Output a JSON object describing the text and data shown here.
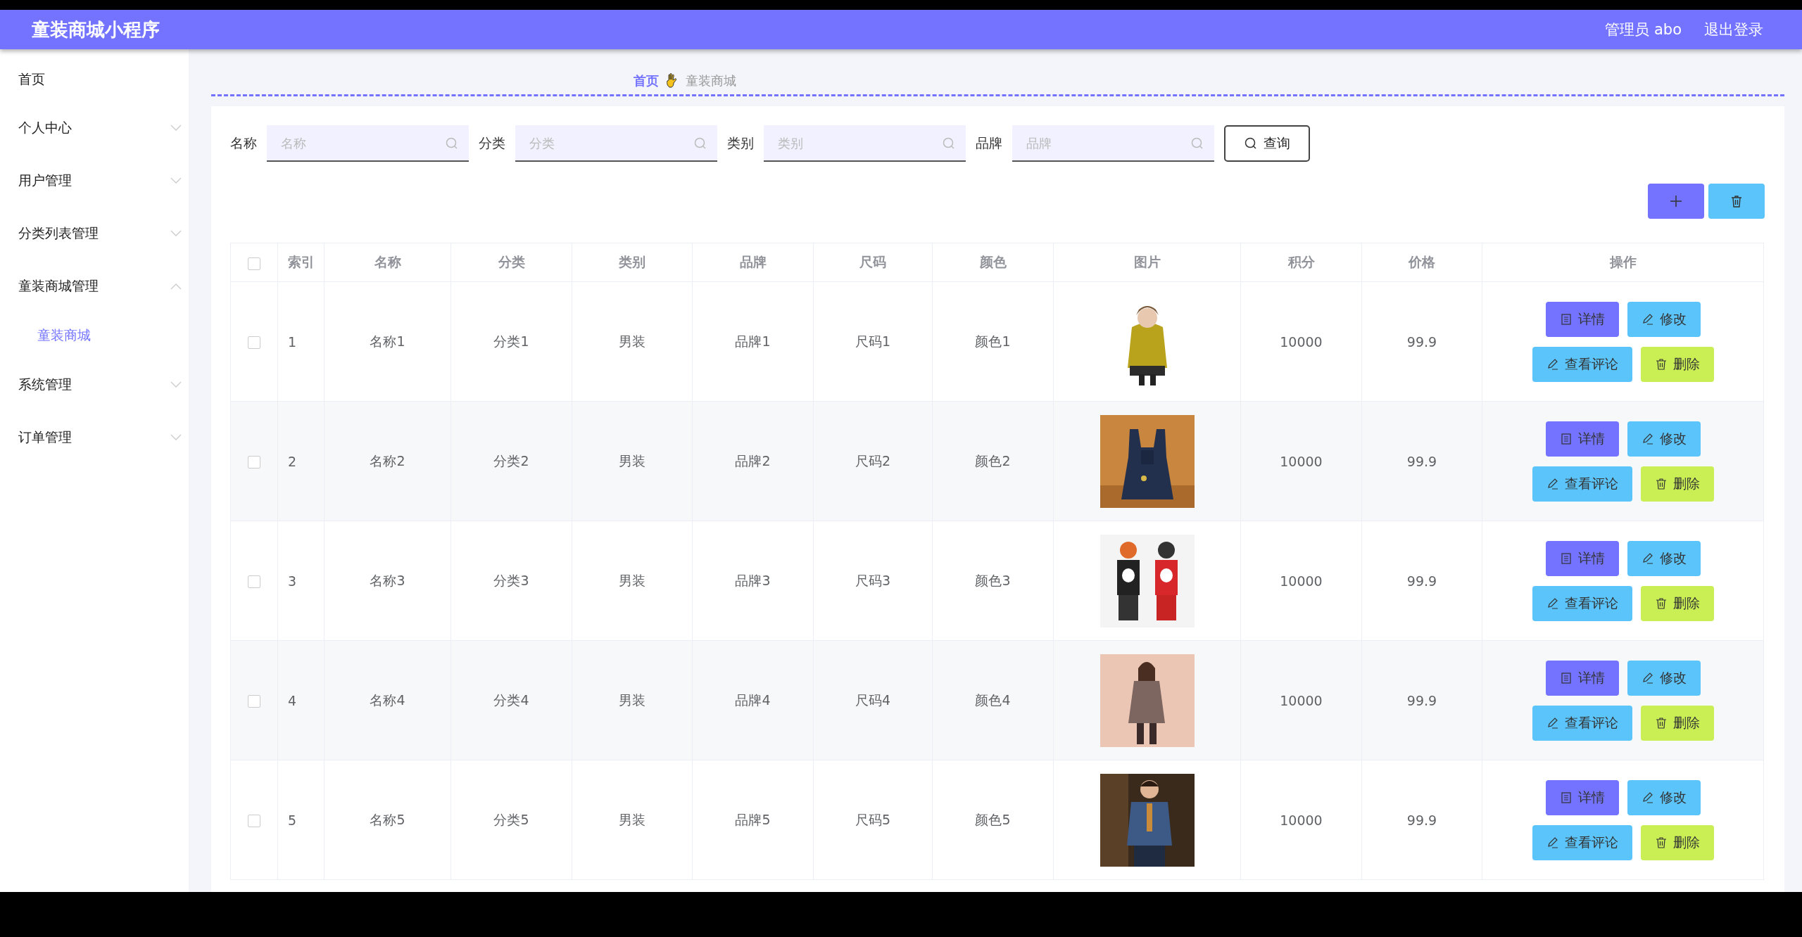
{
  "header": {
    "title": "童装商城小程序",
    "user": "管理员 abo",
    "logout": "退出登录"
  },
  "sidebar": {
    "items": [
      {
        "label": "首页",
        "kind": "link"
      },
      {
        "label": "个人中心",
        "kind": "menu",
        "expanded": false
      },
      {
        "label": "用户管理",
        "kind": "menu",
        "expanded": false
      },
      {
        "label": "分类列表管理",
        "kind": "menu",
        "expanded": false
      },
      {
        "label": "童装商城管理",
        "kind": "menu",
        "expanded": true,
        "children": [
          {
            "label": "童装商城",
            "selected": true
          }
        ]
      },
      {
        "label": "系统管理",
        "kind": "menu",
        "expanded": false
      },
      {
        "label": "订单管理",
        "kind": "menu",
        "expanded": false
      }
    ]
  },
  "breadcrumb": [
    {
      "label": "首页",
      "selected": true
    },
    {
      "label": "童装商城",
      "selected": false
    }
  ],
  "search": {
    "fields": [
      {
        "label": "名称",
        "placeholder": "名称"
      },
      {
        "label": "分类",
        "placeholder": "分类"
      },
      {
        "label": "类别",
        "placeholder": "类别"
      },
      {
        "label": "品牌",
        "placeholder": "品牌"
      }
    ],
    "button": "查询"
  },
  "table": {
    "select_all_checked": false,
    "columns": [
      "索引",
      "名称",
      "分类",
      "类别",
      "品牌",
      "尺码",
      "颜色",
      "图片",
      "积分",
      "价格",
      "操作"
    ],
    "rows": [
      {
        "checked": false,
        "cells": [
          "1",
          "名称1",
          "分类1",
          "男装",
          "品牌1",
          "尺码1",
          "颜色1"
        ],
        "image": {
          "kind": "picture"
        },
        "points": "10000",
        "price": "99.9",
        "actions": [
          {
            "kind": "detail",
            "label": "详情"
          },
          {
            "kind": "edit",
            "label": "修改"
          },
          {
            "kind": "comments",
            "label": "查看评论"
          },
          {
            "kind": "delete",
            "label": "删除"
          }
        ]
      },
      {
        "checked": false,
        "cells": [
          "2",
          "名称2",
          "分类2",
          "男装",
          "品牌2",
          "尺码2",
          "颜色2"
        ],
        "image": {
          "kind": "picture"
        },
        "points": "10000",
        "price": "99.9",
        "actions": [
          {
            "kind": "detail",
            "label": "详情"
          },
          {
            "kind": "edit",
            "label": "修改"
          },
          {
            "kind": "comments",
            "label": "查看评论"
          },
          {
            "kind": "delete",
            "label": "删除"
          }
        ]
      },
      {
        "checked": false,
        "cells": [
          "3",
          "名称3",
          "分类3",
          "男装",
          "品牌3",
          "尺码3",
          "颜色3"
        ],
        "image": {
          "kind": "picture"
        },
        "points": "10000",
        "price": "99.9",
        "actions": [
          {
            "kind": "detail",
            "label": "详情"
          },
          {
            "kind": "edit",
            "label": "修改"
          },
          {
            "kind": "comments",
            "label": "查看评论"
          },
          {
            "kind": "delete",
            "label": "删除"
          }
        ]
      },
      {
        "checked": false,
        "cells": [
          "4",
          "名称4",
          "分类4",
          "男装",
          "品牌4",
          "尺码4",
          "颜色4"
        ],
        "image": {
          "kind": "picture"
        },
        "points": "10000",
        "price": "99.9",
        "actions": [
          {
            "kind": "detail",
            "label": "详情"
          },
          {
            "kind": "edit",
            "label": "修改"
          },
          {
            "kind": "comments",
            "label": "查看评论"
          },
          {
            "kind": "delete",
            "label": "删除"
          }
        ]
      },
      {
        "checked": false,
        "cells": [
          "5",
          "名称5",
          "分类5",
          "男装",
          "品牌5",
          "尺码5",
          "颜色5"
        ],
        "image": {
          "kind": "picture"
        },
        "points": "10000",
        "price": "99.9",
        "actions": [
          {
            "kind": "detail",
            "label": "详情"
          },
          {
            "kind": "edit",
            "label": "修改"
          },
          {
            "kind": "comments",
            "label": "查看评论"
          },
          {
            "kind": "delete",
            "label": "删除"
          }
        ]
      }
    ]
  }
}
